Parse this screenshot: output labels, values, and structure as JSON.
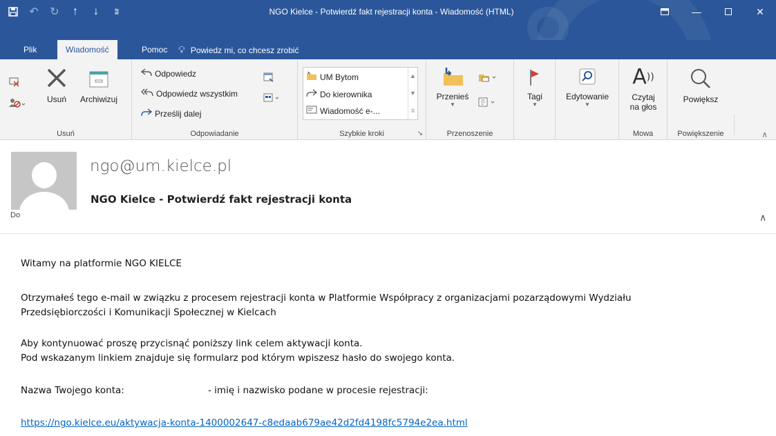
{
  "window": {
    "title": "NGO Kielce - Potwierdź fakt rejestracji konta  -  Wiadomość (HTML)",
    "qat": [
      "save-icon",
      "undo-icon",
      "redo-icon",
      "up-arrow-icon",
      "down-arrow-icon",
      "customize-qat-icon"
    ],
    "controls": [
      "ribbon-display-icon",
      "minimize-icon",
      "maximize-icon",
      "close-icon"
    ]
  },
  "tabs": [
    {
      "label": "Plik",
      "active": false
    },
    {
      "label": "Wiadomość",
      "active": true
    },
    {
      "label": "Pomoc",
      "active": false
    }
  ],
  "tellme": {
    "label": "Powiedz mi, co chcesz zrobić"
  },
  "ribbon": {
    "groups": {
      "usun": "Usuń",
      "odpowiadanie": "Odpowiadanie",
      "szybkie": "Szybkie kroki",
      "przenoszenie": "Przenoszenie",
      "mowa": "Mowa",
      "powiekszenie": "Powiększenie"
    },
    "usun_btn": "Usuń",
    "archiwizuj_btn": "Archiwizuj",
    "odpowiedz": "Odpowiedz",
    "odpowiedz_wszystkim": "Odpowiedz wszystkim",
    "przeslij": "Prześlij dalej",
    "quick_steps": [
      "UM Bytom",
      "Do kierownika",
      "Wiadomość e-..."
    ],
    "przenies": "Przenieś",
    "tagi": "Tagi",
    "edytowanie": "Edytowanie",
    "czytaj_1": "Czytaj",
    "czytaj_2": "na głos",
    "powieksz": "Powiększ"
  },
  "message": {
    "sender": "ngo@um.kielce.pl",
    "subject": "NGO Kielce - Potwierdź fakt rejestracji konta",
    "to_label": "Do"
  },
  "body": {
    "greeting": "Witamy na platformie NGO KIELCE",
    "para1_line1": "Otrzymałeś tego e-mail w związku z procesem rejestracji konta w Platformie Współpracy z organizacjami pozarządowymi Wydziału",
    "para1_line2": "Przedsiębiorczości i Komunikacji Społecznej w Kielcach",
    "para2_line1": "Aby kontynuować proszę przycisnąć poniższy link celem aktywacji konta.",
    "para2_line2": "Pod wskazanym linkiem znajduje się formularz pod którym wpiszesz hasło do swojego konta.",
    "account_label": "Nazwa Twojego konta:",
    "account_note": "- imię i nazwisko podane w procesie rejestracji:",
    "link": "https://ngo.kielce.eu/aktywacja-konta-1400002647-c8edaab679ae42d2fd4198fc5794e2ea.html"
  },
  "colors": {
    "titlebar": "#2b579a",
    "ribbon": "#f3f3f3",
    "link": "#0563c1",
    "avatar": "#c6c6c6"
  }
}
